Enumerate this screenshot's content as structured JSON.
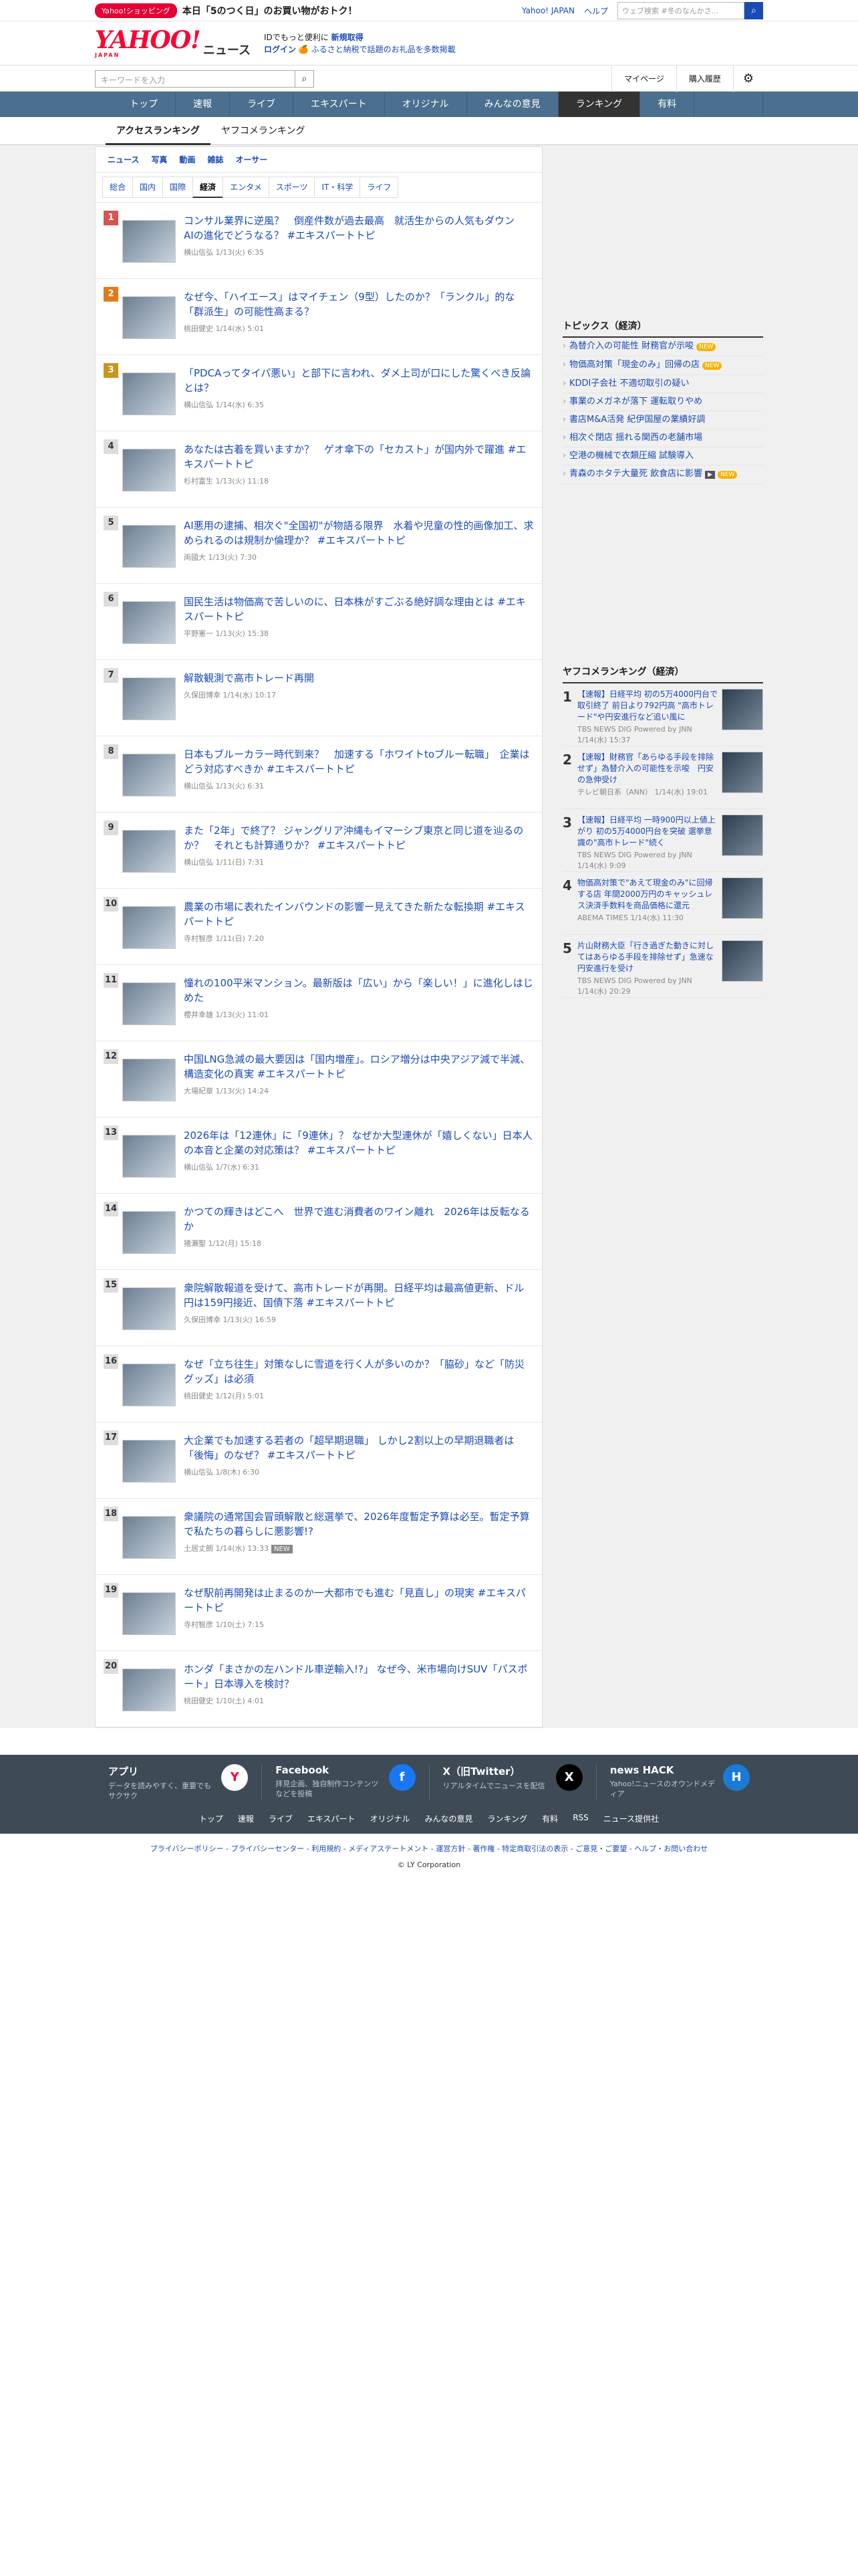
{
  "promo": {
    "badge": "Yahoo!ショッピング",
    "text": "本日「5のつく日」のお買い物がおトク！",
    "links": [
      "Yahoo! JAPAN",
      "ヘルプ"
    ],
    "search_placeholder": "ウェブ検索",
    "search_hint": "#冬のなんかさ..."
  },
  "header": {
    "logo": "YAHOO!",
    "logo_sub": "JAPAN",
    "logo_service": "ニュース",
    "info_line1": "IDでもっと便利に",
    "info_line1_link": "新規取得",
    "info_login": "ログイン",
    "info_line2": "ふるさと納税で話題のお礼品を多数掲載"
  },
  "search": {
    "placeholder": "キーワードを入力",
    "links": [
      "マイページ",
      "購入履歴"
    ]
  },
  "gnav": [
    "トップ",
    "速報",
    "ライブ",
    "エキスパート",
    "オリジナル",
    "みんなの意見",
    "ランキング",
    "有料"
  ],
  "rtabs": [
    "アクセスランキング",
    "ヤフコメランキング"
  ],
  "cat1": [
    "ニュース",
    "写真",
    "動画",
    "雑誌",
    "オーサー"
  ],
  "cat2": [
    "総合",
    "国内",
    "国際",
    "経済",
    "エンタメ",
    "スポーツ",
    "IT・科学",
    "ライフ"
  ],
  "items": [
    {
      "rank": "1",
      "title": "コンサル業界に逆風？　倒産件数が過去最高　就活生からの人気もダウン　AIの進化でどうなる？ #エキスパートトピ",
      "meta": "横山信弘  1/13(火) 6:35"
    },
    {
      "rank": "2",
      "title": "なぜ今、「ハイエース」はマイチェン（9型）したのか？「ランクル」的な「群派生」の可能性高まる？",
      "meta": "桃田健史  1/14(水) 5:01"
    },
    {
      "rank": "3",
      "title": "「PDCAってタイパ悪い」と部下に言われ、ダメ上司が口にした驚くべき反論とは？",
      "meta": "横山信弘  1/14(水) 6:35"
    },
    {
      "rank": "4",
      "title": "あなたは古着を買いますか？　ゲオ傘下の「セカスト」が国内外で躍進 #エキスパートトピ",
      "meta": "杉村富生  1/13(火) 11:18"
    },
    {
      "rank": "5",
      "title": "AI悪用の逮捕、相次ぐ\"全国初\"が物語る限界　水着や児童の性的画像加工、求められるのは規制か倫理か？ #エキスパートトピ",
      "meta": "両國大  1/13(火) 7:30"
    },
    {
      "rank": "6",
      "title": "国民生活は物価高で苦しいのに、日本株がすごぶる絶好調な理由とは #エキスパートトピ",
      "meta": "平野憲一  1/13(火) 15:38"
    },
    {
      "rank": "7",
      "title": "解散観測で高市トレード再開",
      "meta": "久保田博幸  1/14(水) 10:17"
    },
    {
      "rank": "8",
      "title": "日本もブルーカラー時代到来？　加速する「ホワイトtoブルー転職」　企業はどう対応すべきか #エキスパートトピ",
      "meta": "横山信弘  1/13(火) 6:31"
    },
    {
      "rank": "9",
      "title": "また「2年」で終了？ ジャングリア沖縄もイマーシブ東京と同じ道を辿るのか？　それとも計算通りか？ #エキスパートトピ",
      "meta": "横山信弘  1/11(日) 7:31"
    },
    {
      "rank": "10",
      "title": "農業の市場に表れたインバウンドの影響ー見えてきた新たな転換期 #エキスパートトピ",
      "meta": "寺村智彦  1/11(日) 7:20"
    },
    {
      "rank": "11",
      "title": "憧れの100平米マンション。最新版は「広い」から「楽しい！」に進化しはじめた",
      "meta": "櫻井幸雄  1/13(火) 11:01"
    },
    {
      "rank": "12",
      "title": "中国LNG急減の最大要因は「国内増産」。ロシア増分は中央アジア減で半減、構造変化の真実 #エキスパートトピ",
      "meta": "大場紀章  1/13(火) 14:24"
    },
    {
      "rank": "13",
      "title": "2026年は「12連休」に「9連休」？ なぜか大型連休が「嬉しくない」日本人の本音と企業の対応策は？ #エキスパートトピ",
      "meta": "横山信弘  1/7(水) 6:31"
    },
    {
      "rank": "14",
      "title": "かつての輝きはどこへ　世界で進む消費者のワイン離れ　2026年は反転なるか",
      "meta": "猪瀬聖  1/12(月) 15:18"
    },
    {
      "rank": "15",
      "title": "衆院解散報道を受けて、高市トレードが再開。日経平均は最高値更新、ドル円は159円接近、国債下落 #エキスパートトピ",
      "meta": "久保田博幸  1/13(火) 16:59"
    },
    {
      "rank": "16",
      "title": "なぜ「立ち往生」対策なしに雪道を行く人が多いのか？「脇砂」など「防災グッズ」は必須",
      "meta": "桃田健史  1/12(月) 5:01"
    },
    {
      "rank": "17",
      "title": "大企業でも加速する若者の「超早期退職」 しかし2割以上の早期退職者は「後悔」のなぜ？ #エキスパートトピ",
      "meta": "横山信弘  1/8(木) 6:30"
    },
    {
      "rank": "18",
      "title": "衆議院の通常国会冒頭解散と総選挙で、2026年度暫定予算は必至。暫定予算で私たちの暮らしに悪影響!?",
      "meta": "土居丈朗  1/14(水) 13:33",
      "tag": "NEW"
    },
    {
      "rank": "19",
      "title": "なぜ駅前再開発は止まるのか一大都市でも進む「見直し」の現実 #エキスパートトピ",
      "meta": "寺村智彦  1/10(土) 7:15"
    },
    {
      "rank": "20",
      "title": "ホンダ「まさかの左ハンドル車逆輸入!?」 なぜ今、米市場向けSUV「パスポート」日本導入を検討？",
      "meta": "桃田健史  1/10(土) 4:01"
    }
  ],
  "topics": {
    "title": "トピックス（経済）",
    "items": [
      {
        "label": "為替介入の可能性 財務官が示唆",
        "badge": "NEW"
      },
      {
        "label": "物価高対策「現金のみ」回帰の店",
        "badge": "NEW"
      },
      {
        "label": "KDDI子会社 不適切取引の疑い",
        "badge": ""
      },
      {
        "label": "事業のメガネが落下 運転取りやめ",
        "badge": ""
      },
      {
        "label": "書店M&A活発 紀伊国屋の業績好調",
        "badge": ""
      },
      {
        "label": "相次ぐ閉店 揺れる関西の老舗市場",
        "badge": ""
      },
      {
        "label": "空港の機械で衣類圧縮 試験導入",
        "badge": ""
      },
      {
        "label": "青森のホタテ大量死 飲食店に影響",
        "badge": "NEW",
        "video": "▶"
      }
    ]
  },
  "yr": {
    "title": "ヤフコメランキング（経済）",
    "items": [
      {
        "rank": "1",
        "title": "【速報】日経平均 初の5万4000円台で取引終了 前日より792円高 \"高市トレード\"や円安進行など追い風に",
        "src": "TBS NEWS DIG Powered by JNN",
        "time": "1/14(水) 15:37"
      },
      {
        "rank": "2",
        "title": "【速報】財務官「あらゆる手段を排除せず」為替介入の可能性を示唆　円安の急伸受け",
        "src": "テレビ朝日系（ANN）",
        "time": "1/14(水) 19:01"
      },
      {
        "rank": "3",
        "title": "【速報】日経平均 一時900円以上値上がり 初の5万4000円台を突破 選挙意識の\"高市トレード\"続く",
        "src": "TBS NEWS DIG Powered by JNN",
        "time": "1/14(水) 9:09"
      },
      {
        "rank": "4",
        "title": "物価高対策で\"あえて現金のみ\"に回帰する店 年間2000万円のキャッシュレス決済手数料を商品価格に還元",
        "src": "ABEMA TIMES",
        "time": "1/14(水) 11:30"
      },
      {
        "rank": "5",
        "title": "片山財務大臣「行き過ぎた動きに対してはあらゆる手段を排除せず」急速な円安進行を受け",
        "src": "TBS NEWS DIG Powered by JNN",
        "time": "1/14(水) 20:29"
      }
    ]
  },
  "footer": {
    "apps": [
      {
        "h": "アプリ",
        "d": "データを読みやすく、重要でもサクサク",
        "icon": "Y"
      },
      {
        "h": "Facebook",
        "d": "拝見企画、独自制作コンテンツなどを投稿",
        "icon": "f"
      },
      {
        "h": "X（旧Twitter）",
        "d": "リアルタイムでニュースを配信",
        "icon": "X"
      },
      {
        "h": "news HACK",
        "d": "Yahoo!ニュースのオウンドメディア",
        "icon": "H"
      }
    ],
    "links": [
      "トップ",
      "速報",
      "ライブ",
      "エキスパート",
      "オリジナル",
      "みんなの意見",
      "ランキング",
      "有料",
      "RSS",
      "ニュース提供社"
    ],
    "bottom": "プライバシーポリシー - プライバシーセンター - 利用規約 - メディアステートメント - 運営方針 - 著作権 - 特定商取引法の表示 - ご意見・ご要望 - ヘルプ・お問い合わせ",
    "copy": "© LY Corporation"
  }
}
